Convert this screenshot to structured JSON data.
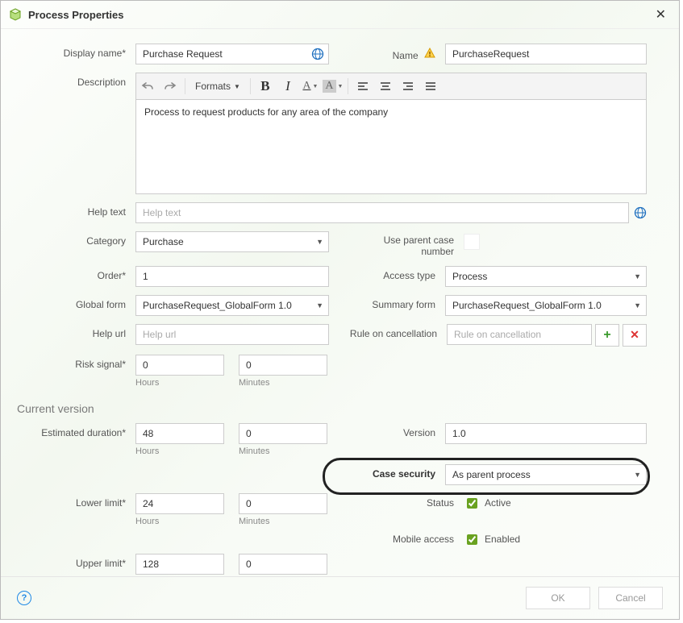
{
  "title": "Process Properties",
  "labels": {
    "display_name": "Display name*",
    "name": "Name",
    "description": "Description",
    "help_text": "Help text",
    "category": "Category",
    "use_parent": "Use parent case number",
    "order": "Order*",
    "access_type": "Access type",
    "global_form": "Global form",
    "summary_form": "Summary form",
    "help_url": "Help url",
    "rule_cancel": "Rule on cancellation",
    "risk_signal": "Risk signal*",
    "current_version": "Current version",
    "est_duration": "Estimated duration*",
    "version": "Version",
    "case_security": "Case security",
    "lower_limit": "Lower limit*",
    "status": "Status",
    "upper_limit": "Upper limit*",
    "mobile": "Mobile access",
    "hours": "Hours",
    "minutes": "Minutes",
    "ok": "OK",
    "cancel": "Cancel",
    "formats": "Formats",
    "active": "Active",
    "enabled": "Enabled"
  },
  "placeholders": {
    "help_text": "Help text",
    "help_url": "Help url",
    "rule_cancel": "Rule on cancellation"
  },
  "values": {
    "display_name": "Purchase Request",
    "name": "PurchaseRequest",
    "description": "Process to request products for any area of the company",
    "category": "Purchase",
    "order": "1",
    "access_type": "Process",
    "global_form": "PurchaseRequest_GlobalForm 1.0",
    "summary_form": "PurchaseRequest_GlobalForm 1.0",
    "risk_hours": "0",
    "risk_minutes": "0",
    "est_hours": "48",
    "est_minutes": "0",
    "version": "1.0",
    "case_security": "As parent process",
    "lower_hours": "24",
    "lower_minutes": "0",
    "upper_hours": "128",
    "upper_minutes": "0",
    "status_checked": true,
    "mobile_checked": true
  }
}
